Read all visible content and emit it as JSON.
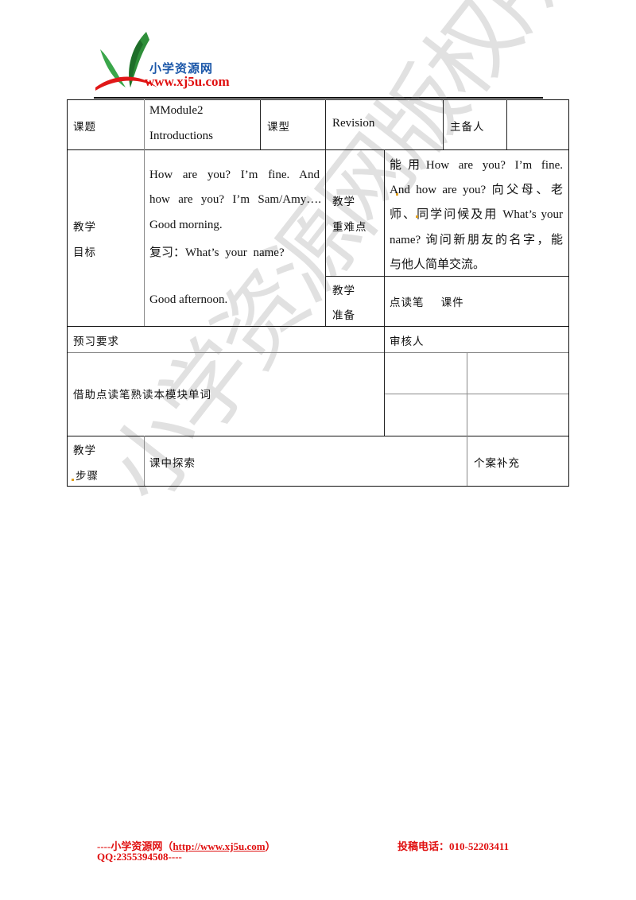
{
  "header": {
    "logo_cn": "小学资源网",
    "logo_url": "www.xj5u.com"
  },
  "table": {
    "row1": {
      "topic_label": "课题",
      "topic_value_line1": "MModule2",
      "topic_value_line2": "Introductions",
      "type_label": "课型",
      "type_value": "Revision",
      "preparer_label": "主备人",
      "preparer_value": ""
    },
    "goals": {
      "label_line1": "教学",
      "label_line2": "目标",
      "lines": [
        "How are you? I’m fine. And",
        "how are you? I’m Sam/Amy….",
        "Good morning.",
        "复习：What’s your name?",
        "",
        "Good afternoon."
      ]
    },
    "key_points": {
      "label_line1": "教学",
      "label_line2": "重难点",
      "lines": [
        "能用How are you? I’m fine.",
        "And how are you? 向父母、老",
        "师、同学问候及用 What’s your",
        "name? 询问新朋友的名字，能",
        "与他人简单交流。"
      ]
    },
    "preparation": {
      "label_line1": "教学",
      "label_line2": "准备",
      "value": "点读笔    课件"
    },
    "preview": {
      "label": "预习要求",
      "reviewer_label": "审核人",
      "content": "借助点读笔熟读本模块单词"
    },
    "steps": {
      "label_line1": "教学",
      "label_line2": "步骤",
      "middle": "课中探索",
      "right": "个案补充"
    }
  },
  "watermark": "小学资源网版权所有",
  "footer": {
    "prefix": "----小学资源网（",
    "link": "http://www.xj5u.com",
    "suffix": "）",
    "phone": "投稿电话：010-52203411",
    "qq": "QQ:2355394508----"
  }
}
